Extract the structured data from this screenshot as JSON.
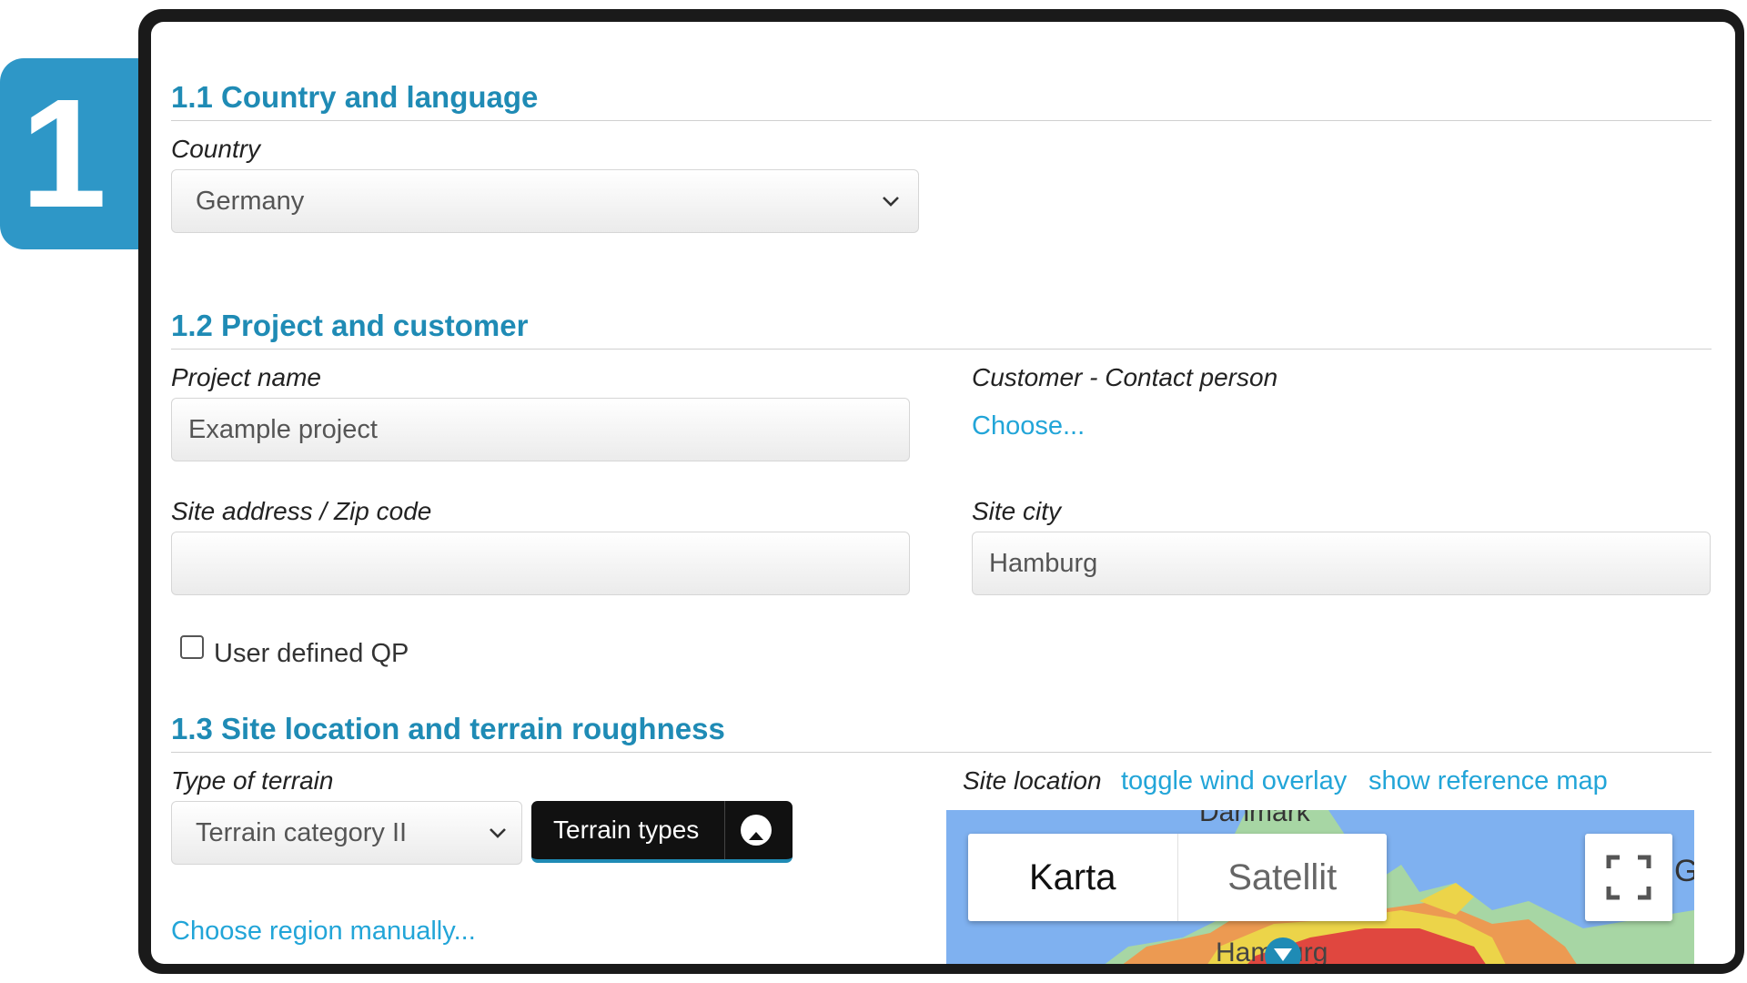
{
  "step": {
    "number": "1"
  },
  "sections": {
    "s1": {
      "title": "1.1 Country and language"
    },
    "s2": {
      "title": "1.2 Project and customer"
    },
    "s3": {
      "title": "1.3 Site location and terrain roughness"
    }
  },
  "country": {
    "label": "Country",
    "value": "Germany"
  },
  "project": {
    "name_label": "Project name",
    "name_value": "Example project",
    "customer_label": "Customer - Contact person",
    "customer_link": "Choose...",
    "address_label": "Site address / Zip code",
    "address_value": "",
    "city_label": "Site city",
    "city_value": "Hamburg",
    "qp_label": "User defined QP",
    "qp_checked": false
  },
  "terrain": {
    "type_label": "Type of terrain",
    "type_value": "Terrain category II",
    "terrain_types_button": "Terrain types",
    "choose_region_link": "Choose region manually..."
  },
  "site_location": {
    "label": "Site location",
    "toggle_wind_link": "toggle wind overlay",
    "reference_map_link": "show reference map",
    "map_tab_map": "Karta",
    "map_tab_satellite": "Satellit",
    "map_label_city": "Hamburg",
    "map_label_country": "Danmark",
    "map_label_partial": "G"
  },
  "colors": {
    "accent": "#1f8bb5",
    "link": "#22a5d8",
    "badge": "#2e97c7",
    "map_water": "#7fb1f0",
    "map_zone_red": "#e0473f",
    "map_zone_yellow": "#ecd449",
    "map_zone_orange": "#ec9a52",
    "map_zone_green": "#a7d6a4"
  }
}
